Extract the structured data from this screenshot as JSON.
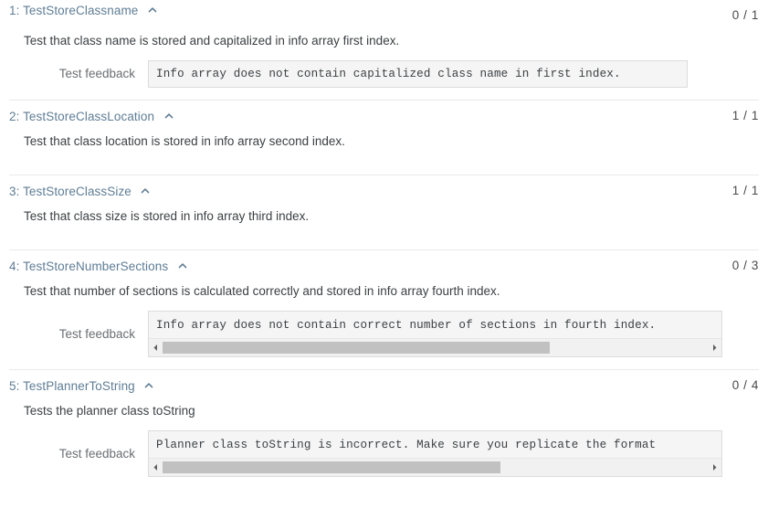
{
  "feedback_label": "Test feedback",
  "icons": {
    "collapse_chevron": "chevron-up-icon",
    "scroll_left": "scroll-arrow-left-icon",
    "scroll_right": "scroll-arrow-right-icon"
  },
  "colors": {
    "title": "#5f7d95",
    "body_text": "#3c4043",
    "label_text": "#6b6f73",
    "divider": "#e8eaed",
    "feedback_bg": "#f5f5f5",
    "feedback_border": "#dcdcdc",
    "scroll_thumb": "#c1c1c1",
    "scroll_track": "#f1f1f1"
  },
  "tests": [
    {
      "index": "1",
      "title": "1: TestStoreClassname",
      "score": "0 / 1",
      "description": "Test that class name is stored and capitalized in info array first index.",
      "feedback": "Info array does not contain capitalized class name in first index.",
      "has_feedback": true,
      "has_scrollbar": false,
      "scroll_thumb_pct": 0
    },
    {
      "index": "2",
      "title": "2: TestStoreClassLocation",
      "score": "1 / 1",
      "description": "Test that class location is stored in info array second index.",
      "feedback": "",
      "has_feedback": false,
      "has_scrollbar": false,
      "scroll_thumb_pct": 0
    },
    {
      "index": "3",
      "title": "3: TestStoreClassSize",
      "score": "1 / 1",
      "description": "Test that class size is stored in info array third index.",
      "feedback": "",
      "has_feedback": false,
      "has_scrollbar": false,
      "scroll_thumb_pct": 0
    },
    {
      "index": "4",
      "title": "4: TestStoreNumberSections",
      "score": "0 / 3",
      "description": "Test that number of sections is calculated correctly and stored in info array fourth index.",
      "feedback": "Info array does not contain correct number of sections in fourth index.",
      "has_feedback": true,
      "has_scrollbar": true,
      "scroll_thumb_pct": 71
    },
    {
      "index": "5",
      "title": "5: TestPlannerToString",
      "score": "0 / 4",
      "description": "Tests the planner class toString",
      "feedback": "Planner class toString is incorrect. Make sure you replicate the format",
      "has_feedback": true,
      "has_scrollbar": true,
      "scroll_thumb_pct": 62
    }
  ]
}
